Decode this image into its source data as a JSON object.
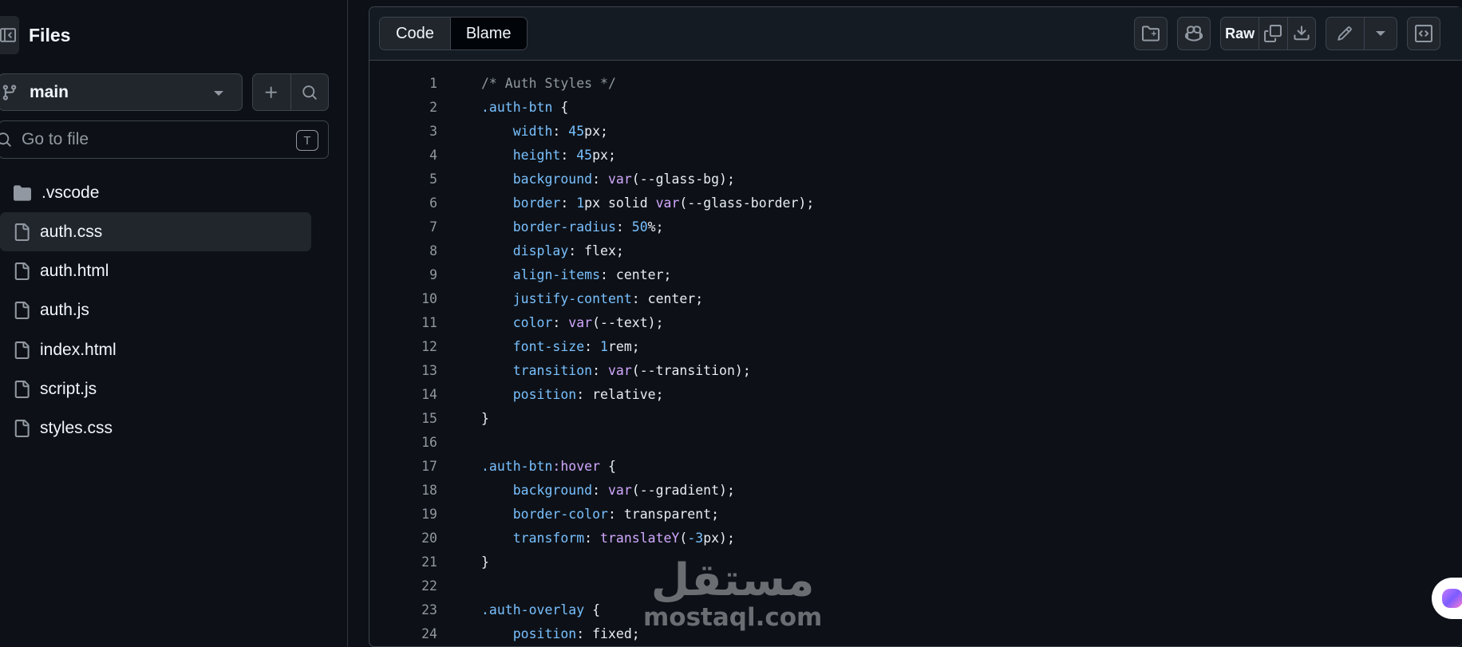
{
  "sidebar": {
    "title": "Files",
    "branch": "main",
    "search_placeholder": "Go to file",
    "search_shortcut": "T",
    "items": [
      {
        "label": ".vscode",
        "icon": "folder-icon"
      },
      {
        "label": "auth.css",
        "icon": "file-icon",
        "active": true
      },
      {
        "label": "auth.html",
        "icon": "file-icon"
      },
      {
        "label": "auth.js",
        "icon": "file-icon"
      },
      {
        "label": "index.html",
        "icon": "file-icon"
      },
      {
        "label": "script.js",
        "icon": "file-icon"
      },
      {
        "label": "styles.css",
        "icon": "file-icon"
      }
    ]
  },
  "toolbar": {
    "tab_code": "Code",
    "tab_blame": "Blame",
    "raw_label": "Raw"
  },
  "code": {
    "lines": [
      {
        "n": "1",
        "html": "<span class=\"c-cm\">/* Auth Styles */</span>"
      },
      {
        "n": "2",
        "html": "<span class=\"c-cls\">.auth-btn</span> {"
      },
      {
        "n": "3",
        "html": "    <span class=\"c-prop\">width</span>: <span class=\"c-num\">45</span>px;"
      },
      {
        "n": "4",
        "html": "    <span class=\"c-prop\">height</span>: <span class=\"c-num\">45</span>px;"
      },
      {
        "n": "5",
        "html": "    <span class=\"c-prop\">background</span>: <span class=\"c-fn\">var</span>(--glass-bg);"
      },
      {
        "n": "6",
        "html": "    <span class=\"c-prop\">border</span>: <span class=\"c-num\">1</span>px solid <span class=\"c-fn\">var</span>(--glass-border);"
      },
      {
        "n": "7",
        "html": "    <span class=\"c-prop\">border-radius</span>: <span class=\"c-num\">50</span>%;"
      },
      {
        "n": "8",
        "html": "    <span class=\"c-prop\">display</span>: flex;"
      },
      {
        "n": "9",
        "html": "    <span class=\"c-prop\">align-items</span>: center;"
      },
      {
        "n": "10",
        "html": "    <span class=\"c-prop\">justify-content</span>: center;"
      },
      {
        "n": "11",
        "html": "    <span class=\"c-prop\">color</span>: <span class=\"c-fn\">var</span>(--text);"
      },
      {
        "n": "12",
        "html": "    <span class=\"c-prop\">font-size</span>: <span class=\"c-num\">1</span>rem;"
      },
      {
        "n": "13",
        "html": "    <span class=\"c-prop\">transition</span>: <span class=\"c-fn\">var</span>(--transition);"
      },
      {
        "n": "14",
        "html": "    <span class=\"c-prop\">position</span>: relative;"
      },
      {
        "n": "15",
        "html": "}"
      },
      {
        "n": "16",
        "html": ""
      },
      {
        "n": "17",
        "html": "<span class=\"c-cls\">.auth-btn</span><span class=\"c-ps\">:hover</span> {"
      },
      {
        "n": "18",
        "html": "    <span class=\"c-prop\">background</span>: <span class=\"c-fn\">var</span>(--gradient);"
      },
      {
        "n": "19",
        "html": "    <span class=\"c-prop\">border-color</span>: transparent;"
      },
      {
        "n": "20",
        "html": "    <span class=\"c-prop\">transform</span>: <span class=\"c-fn\">translateY</span>(<span class=\"c-num\">-3</span>px);"
      },
      {
        "n": "21",
        "html": "}"
      },
      {
        "n": "22",
        "html": ""
      },
      {
        "n": "23",
        "html": "<span class=\"c-cls\">.auth-overlay</span> {"
      },
      {
        "n": "24",
        "html": "    <span class=\"c-prop\">position</span>: fixed;"
      }
    ]
  },
  "watermark": {
    "arabic": "مستقل",
    "latin": "mostaql.com"
  },
  "colors": {
    "background": "#0d1117",
    "toolbar": "#151b23",
    "button": "#21262d",
    "border": "#3d444d"
  }
}
